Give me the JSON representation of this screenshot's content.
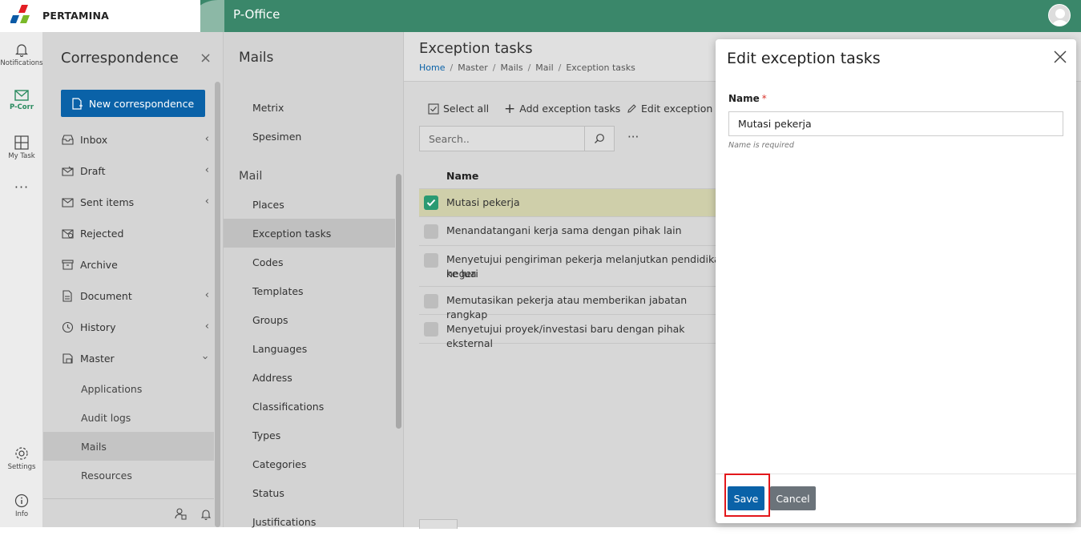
{
  "brand": {
    "logo_text": "PERTAMINA",
    "app_title": "P-Office",
    "header_color": "#3a876a"
  },
  "rail": {
    "notifications": "Notifications",
    "pcorr": "P-Corr",
    "mytask": "My Task",
    "more": "···",
    "settings": "Settings",
    "info": "Info"
  },
  "sidebar": {
    "title": "Correspondence",
    "close": "×",
    "new_button": "New correspondence",
    "items": [
      {
        "label": "Inbox",
        "icon": "inbox-icon"
      },
      {
        "label": "Draft",
        "icon": "draft-icon"
      },
      {
        "label": "Sent items",
        "icon": "sent-icon"
      },
      {
        "label": "Rejected",
        "icon": "rejected-icon"
      },
      {
        "label": "Archive",
        "icon": "archive-icon"
      },
      {
        "label": "Document",
        "icon": "document-icon"
      },
      {
        "label": "History",
        "icon": "history-icon"
      },
      {
        "label": "Master",
        "icon": "master-icon"
      }
    ],
    "sub_items": [
      "Applications",
      "Audit logs",
      "Mails",
      "Resources"
    ]
  },
  "mailnav": {
    "title": "Mails",
    "top_items": [
      "Metrix",
      "Spesimen"
    ],
    "group": "Mail",
    "items": [
      "Places",
      "Exception tasks",
      "Codes",
      "Templates",
      "Groups",
      "Languages",
      "Address",
      "Classifications",
      "Types",
      "Categories",
      "Status",
      "Justifications"
    ]
  },
  "main": {
    "title": "Exception tasks",
    "breadcrumb": [
      "Home",
      "Master",
      "Mails",
      "Mail",
      "Exception tasks"
    ],
    "toolbar": {
      "select_all": "Select all",
      "add": "Add exception tasks",
      "edit": "Edit exception tas"
    },
    "search_placeholder": "Search..",
    "more": "···",
    "column_name": "Name",
    "rows": [
      {
        "text": "Mutasi pekerja",
        "selected": true
      },
      {
        "text": "Menandatangani kerja sama dengan pihak lain",
        "selected": false
      },
      {
        "text": "Menyetujui pengiriman pekerja melanjutkan pendidikan ke luar negeri",
        "line1": "Menyetujui pengiriman pekerja melanjutkan pendidikan ke lua",
        "line2": "negeri",
        "selected": false
      },
      {
        "text": "Memutasikan pekerja atau memberikan jabatan rangkap",
        "selected": false
      },
      {
        "text": "Menyetujui proyek/investasi baru dengan pihak eksternal",
        "selected": false
      }
    ]
  },
  "modal": {
    "title": "Edit exception tasks",
    "field_label": "Name",
    "required_mark": "*",
    "field_value": "Mutasi pekerja",
    "hint": "Name is required",
    "save": "Save",
    "cancel": "Cancel"
  }
}
